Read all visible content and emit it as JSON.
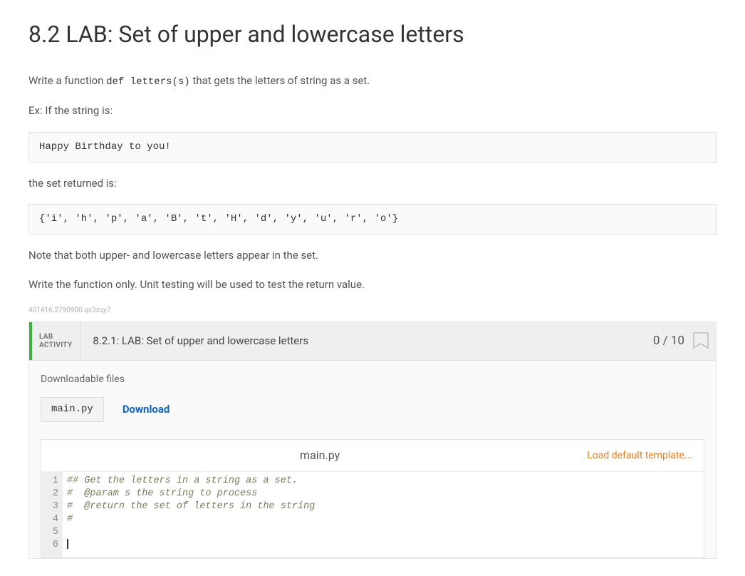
{
  "title": "8.2 LAB: Set of upper and lowercase letters",
  "intro_pre": "Write a function ",
  "intro_code": "def letters(s)",
  "intro_post": " that gets the letters of string as a set.",
  "example_label": "Ex: If the string is:",
  "example_input": "Happy Birthday to you!",
  "result_label": "the set returned is:",
  "example_output": "{'i', 'h', 'p', 'a', 'B', 't', 'H', 'd', 'y', 'u', 'r', 'o'}",
  "note1": "Note that both upper- and lowercase letters appear in the set.",
  "note2": "Write the function only. Unit testing will be used to test the return value.",
  "activity_id": "401416.2790900.qx3zqy7",
  "lab": {
    "badge_line1": "LAB",
    "badge_line2": "ACTIVITY",
    "title": "8.2.1: LAB: Set of upper and lowercase letters",
    "score": "0 / 10"
  },
  "downloadable": {
    "label": "Downloadable files",
    "file": "main.py",
    "link": "Download"
  },
  "editor": {
    "filename": "main.py",
    "load_default": "Load default template...",
    "lines": [
      "## Get the letters in a string as a set.",
      "#  @param s the string to process",
      "#  @return the set of letters in the string",
      "#",
      "",
      ""
    ]
  }
}
